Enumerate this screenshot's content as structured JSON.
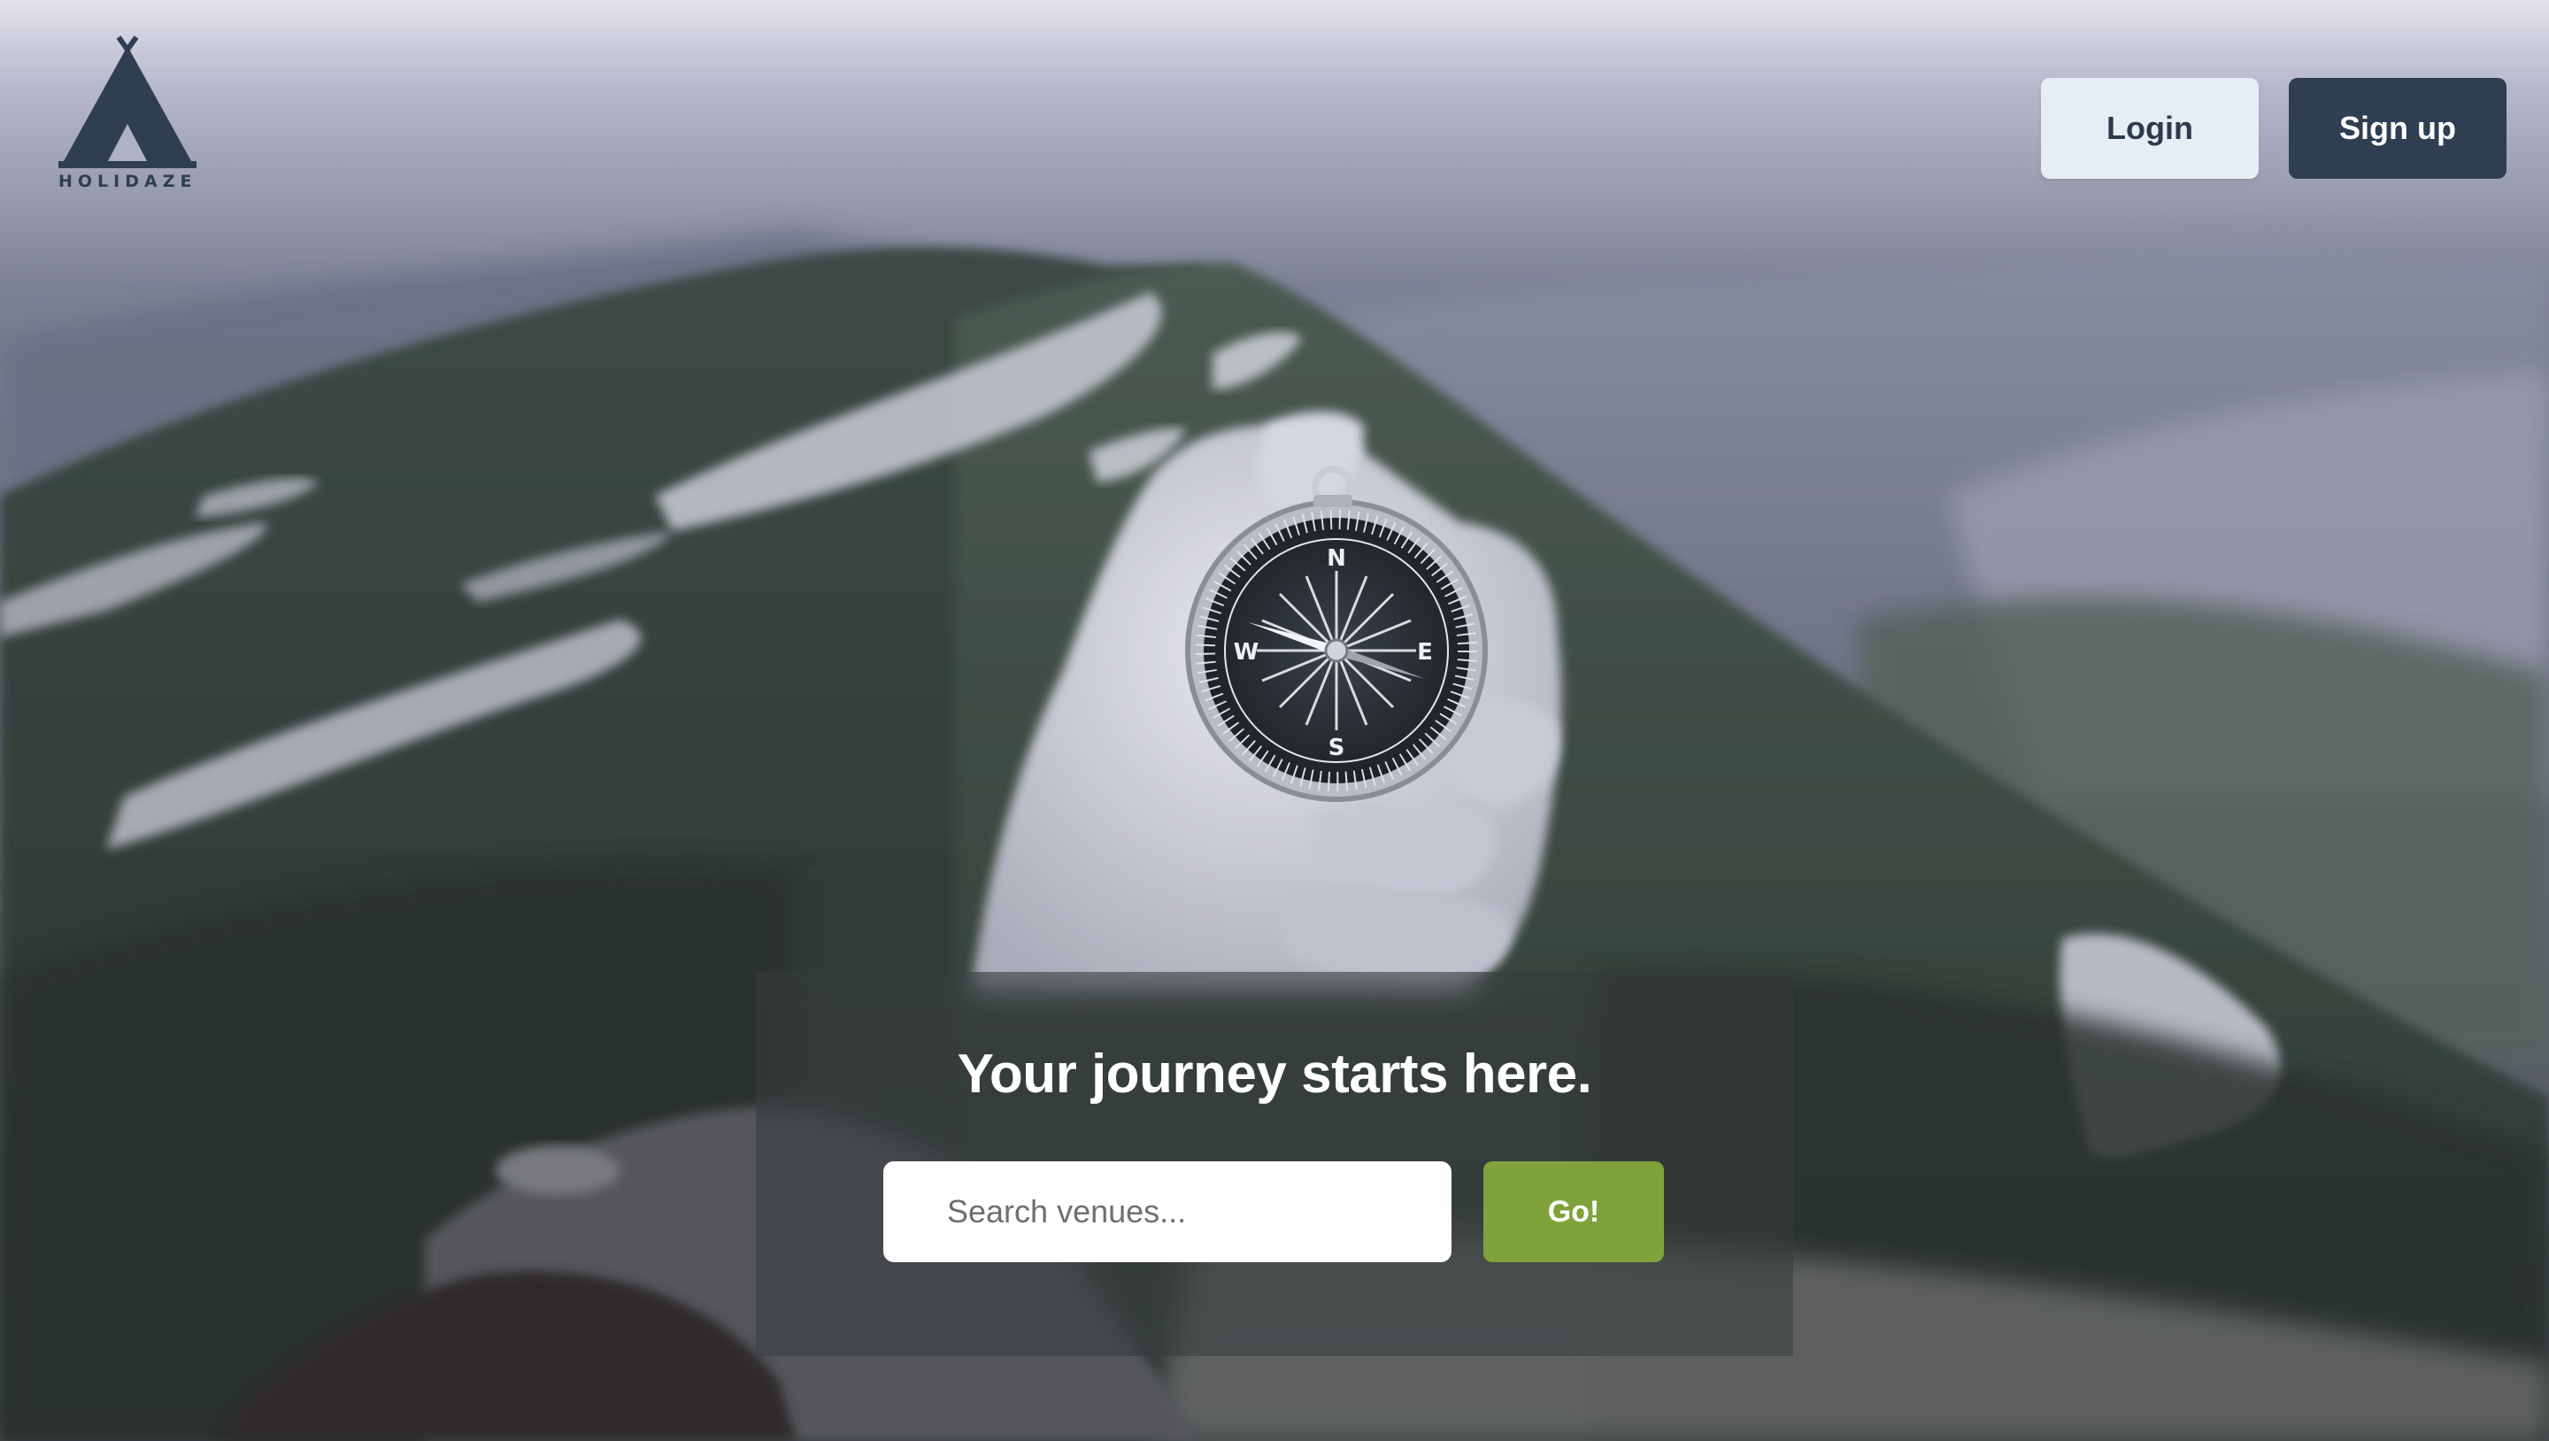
{
  "header": {
    "logo_text": "HOLIDAZE",
    "login_label": "Login",
    "signup_label": "Sign up"
  },
  "hero": {
    "headline": "Your journey starts here.",
    "search": {
      "placeholder": "Search venues...",
      "value": ""
    },
    "go_label": "Go!"
  },
  "colors": {
    "brand_dark": "#2f3e51",
    "login_bg": "#e6edf4",
    "go_green": "#7fa33a"
  },
  "icons": {
    "logo": "tent-logo-icon",
    "compass": "compass-photo"
  }
}
